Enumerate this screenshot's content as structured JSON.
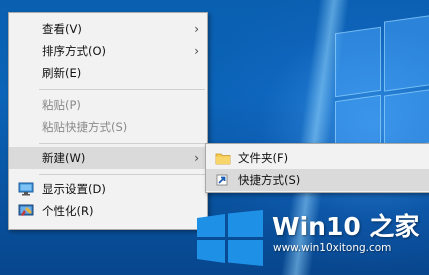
{
  "context_menu": {
    "items": [
      {
        "label": "查看(V)",
        "has_submenu": true,
        "disabled": false
      },
      {
        "label": "排序方式(O)",
        "has_submenu": true,
        "disabled": false
      },
      {
        "label": "刷新(E)",
        "has_submenu": false,
        "disabled": false
      },
      {
        "label": "粘贴(P)",
        "has_submenu": false,
        "disabled": true
      },
      {
        "label": "粘贴快捷方式(S)",
        "has_submenu": false,
        "disabled": true
      },
      {
        "label": "新建(W)",
        "has_submenu": true,
        "disabled": false,
        "highlighted": true
      },
      {
        "label": "显示设置(D)",
        "icon": "display-settings-icon",
        "disabled": false
      },
      {
        "label": "个性化(R)",
        "icon": "personalize-icon",
        "disabled": false
      }
    ],
    "submenu_arrow": "›"
  },
  "new_submenu": {
    "items": [
      {
        "label": "文件夹(F)",
        "icon": "folder-icon"
      },
      {
        "label": "快捷方式(S)",
        "icon": "shortcut-icon",
        "highlighted": true
      }
    ]
  },
  "watermark": {
    "title": "Win10 之家",
    "url": "www.win10xitong.com"
  },
  "colors": {
    "desktop_blue": "#0a5fb0",
    "menu_bg": "#f2f2f2",
    "highlight": "#dadada",
    "disabled_text": "#8a8a8a",
    "logo_blue": "#1e90e6"
  }
}
